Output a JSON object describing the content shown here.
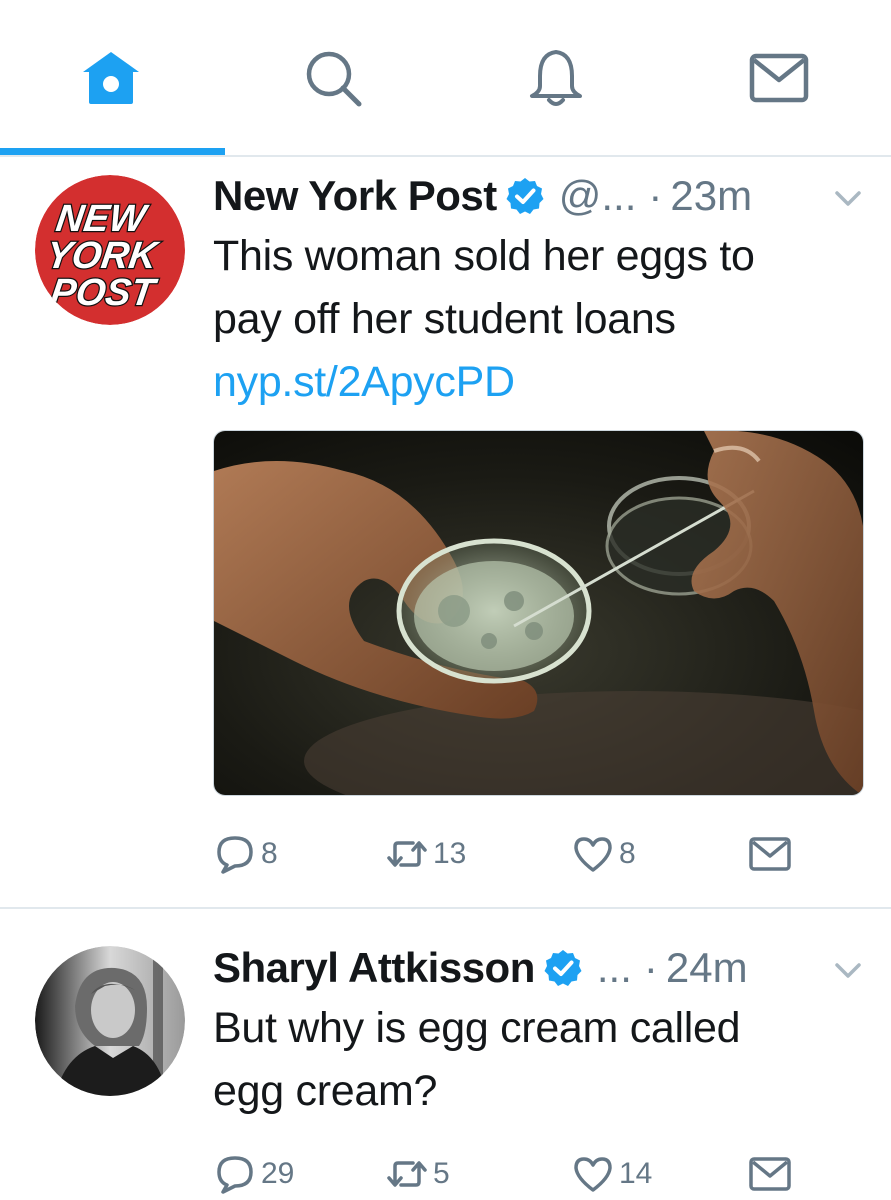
{
  "nav": {
    "items": [
      {
        "name": "home",
        "icon": "home-icon",
        "active": true
      },
      {
        "name": "search",
        "icon": "search-icon",
        "active": false
      },
      {
        "name": "notifications",
        "icon": "bell-icon",
        "active": false
      },
      {
        "name": "messages",
        "icon": "envelope-icon",
        "active": false
      }
    ],
    "accent_color": "#1da1f2"
  },
  "tweets": [
    {
      "avatar_logo_text": [
        "NEW",
        "YORK",
        "POST"
      ],
      "name": "New York Post",
      "verified": true,
      "handle": "@...",
      "separator": "·",
      "time": "23m",
      "text_lines": [
        "This woman sold her eggs to",
        "pay off her student loans"
      ],
      "link": "nyp.st/2ApycPD",
      "media": "photo of hands handling a petri dish with a pipette",
      "replies": "8",
      "retweets": "13",
      "likes": "8"
    },
    {
      "name": "Sharyl Attkisson",
      "verified": true,
      "handle": "...",
      "separator": "·",
      "time": "24m",
      "text_lines": [
        "But why is egg cream called",
        "egg cream?"
      ],
      "replies": "29",
      "retweets": "5",
      "likes": "14"
    }
  ]
}
